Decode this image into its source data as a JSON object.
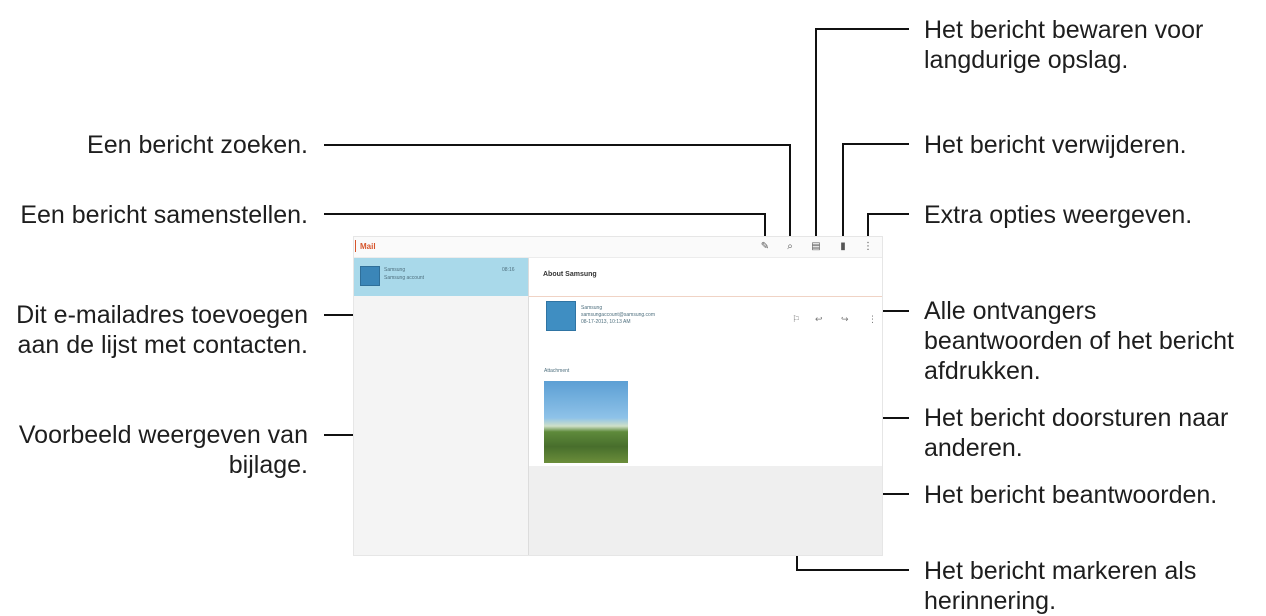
{
  "screen": {
    "app_title": "Mail",
    "message_list": {
      "sender": "Samsung",
      "preview": "Samsung account",
      "time": "08:16"
    },
    "email": {
      "subject": "About Samsung",
      "sender": "Samsung",
      "detail_1": "samsungaccount@samsung.com",
      "detail_2": "08-17-2013, 10:13 AM",
      "attachment_label": "Attachment"
    }
  },
  "callouts": {
    "search": "Een bericht zoeken.",
    "compose": "Een bericht samenstellen.",
    "add_contact_1": "Dit e-mailadres toevoegen",
    "add_contact_2": "aan de lijst met contacten.",
    "preview_1": "Voorbeeld weergeven van",
    "preview_2": "bijlage.",
    "save_1": "Het bericht bewaren voor",
    "save_2": "langdurige opslag.",
    "delete": "Het bericht verwijderen.",
    "more": "Extra opties weergeven.",
    "reply_all_1": "Alle ontvangers",
    "reply_all_2": "beantwoorden of het bericht",
    "reply_all_3": "afdrukken.",
    "forward_1": "Het bericht doorsturen naar",
    "forward_2": "anderen.",
    "reply": "Het bericht beantwoorden.",
    "flag_1": "Het bericht markeren als",
    "flag_2": "herinnering."
  },
  "icons": {
    "compose": "compose-icon",
    "search": "search-icon",
    "save": "save-icon",
    "delete": "delete-icon",
    "more": "more-options-icon",
    "flag": "flag-icon",
    "reply": "reply-icon",
    "forward": "forward-icon",
    "reply_all": "reply-all-icon"
  }
}
